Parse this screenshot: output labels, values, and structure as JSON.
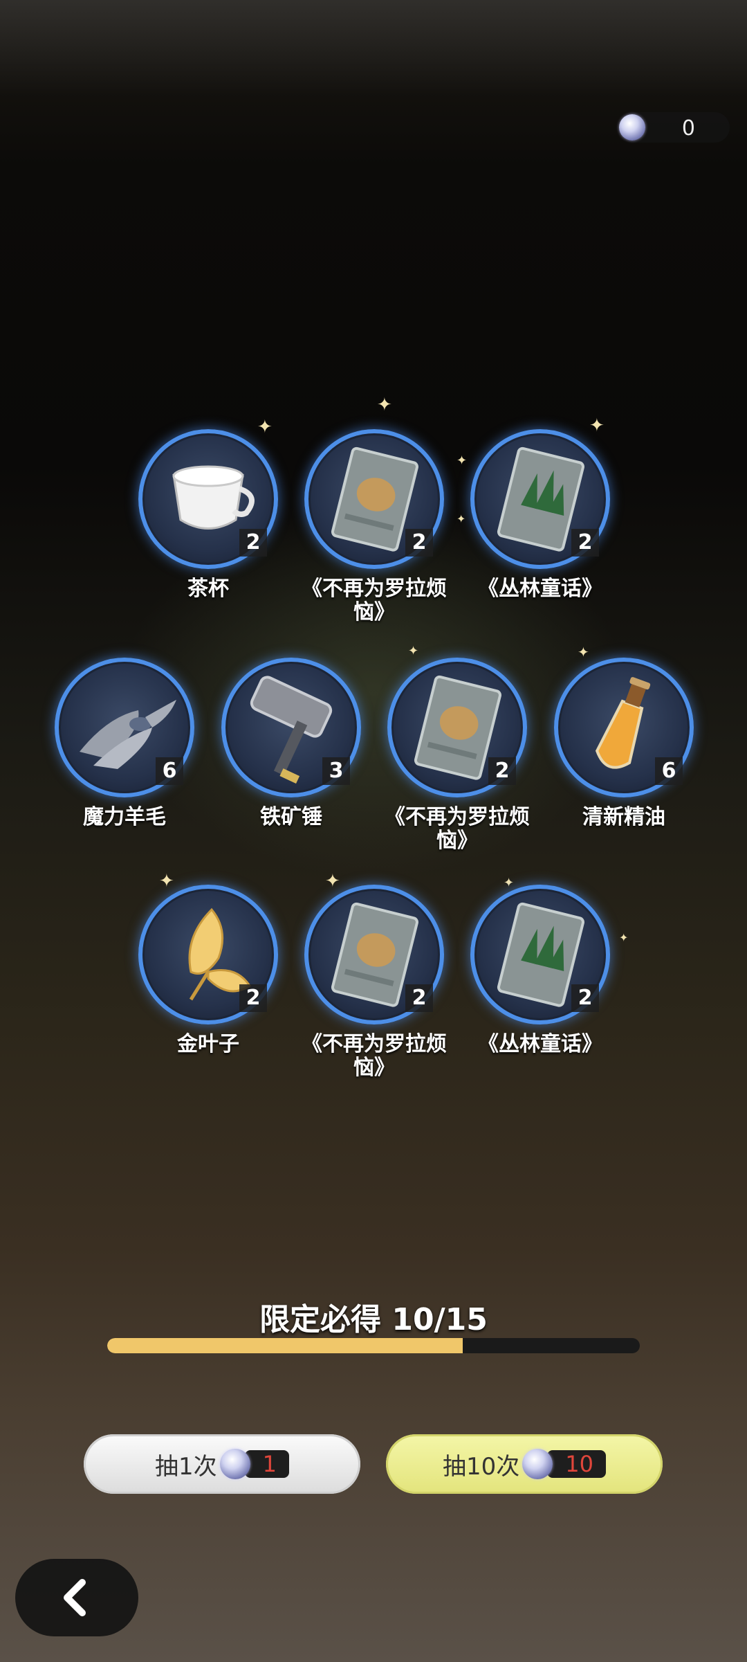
{
  "currency": {
    "amount": "0",
    "icon": "gem-icon"
  },
  "rewards": [
    {
      "name": "茶杯",
      "count": "2",
      "icon": "teacup-icon"
    },
    {
      "name": "《不再为罗拉烦恼》",
      "count": "2",
      "icon": "book-pouch-icon"
    },
    {
      "name": "《丛林童话》",
      "count": "2",
      "icon": "book-forest-icon"
    },
    {
      "name": "魔力羊毛",
      "count": "6",
      "icon": "wool-icon"
    },
    {
      "name": "铁矿锤",
      "count": "3",
      "icon": "hammer-icon"
    },
    {
      "name": "《不再为罗拉烦恼》",
      "count": "2",
      "icon": "book-pouch-icon"
    },
    {
      "name": "清新精油",
      "count": "6",
      "icon": "oil-bottle-icon"
    },
    {
      "name": "金叶子",
      "count": "2",
      "icon": "gold-leaf-icon"
    },
    {
      "name": "《不再为罗拉烦恼》",
      "count": "2",
      "icon": "book-pouch-icon"
    },
    {
      "name": "《丛林童话》",
      "count": "2",
      "icon": "book-forest-icon"
    }
  ],
  "pity": {
    "label": "限定必得 10/15",
    "progress": 0.667,
    "color": "#f0c76a"
  },
  "buttons": {
    "single": {
      "label": "抽1次",
      "cost": "1"
    },
    "ten": {
      "label": "抽10次",
      "cost": "10"
    }
  },
  "colors": {
    "accent_ring": "#4d8fe8",
    "cost_red": "#e0463b"
  }
}
